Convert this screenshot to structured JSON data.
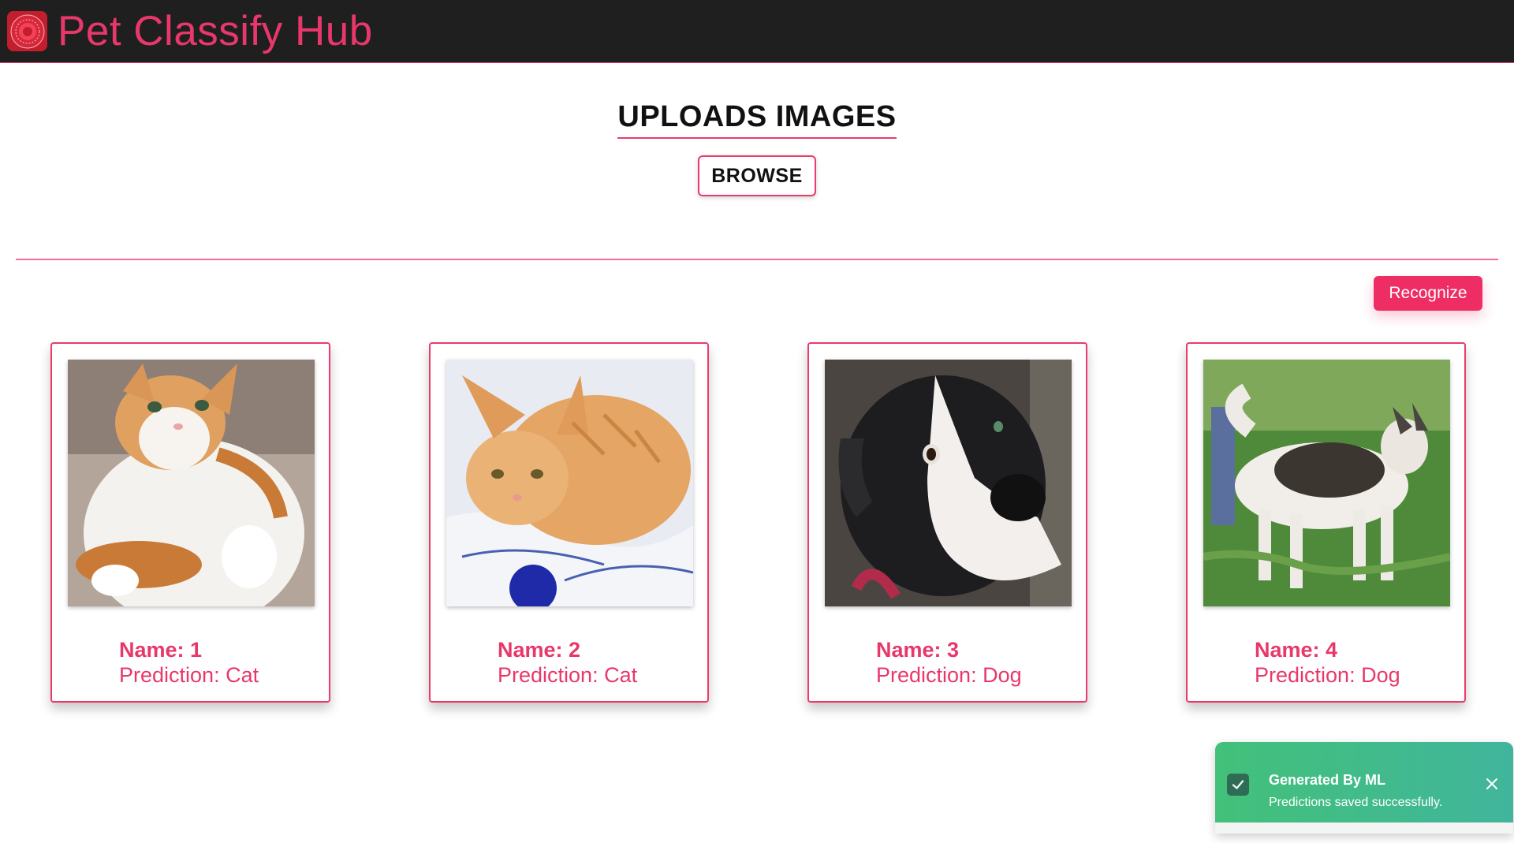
{
  "app": {
    "title": "Pet Classify Hub",
    "logo_icon": "paw-seal-icon",
    "accent_color": "#ea3b6c",
    "header_bg": "#201f1f"
  },
  "upload": {
    "heading": "UPLOADS IMAGES",
    "browse_label": "BROWSE"
  },
  "actions": {
    "recognize_label": "Recognize"
  },
  "results": [
    {
      "name_label": "Name: 1",
      "prediction_label": "Prediction: Cat",
      "image_subject": "orange-white-cat"
    },
    {
      "name_label": "Name: 2",
      "prediction_label": "Prediction: Cat",
      "image_subject": "orange-tabby-cat"
    },
    {
      "name_label": "Name: 3",
      "prediction_label": "Prediction: Dog",
      "image_subject": "black-white-dog"
    },
    {
      "name_label": "Name: 4",
      "prediction_label": "Prediction: Dog",
      "image_subject": "husky-on-grass"
    }
  ],
  "toast": {
    "title": "Generated By ML",
    "message": "Predictions saved successfully.",
    "icon": "check-icon",
    "close_icon": "close-icon",
    "color": "#42c179"
  }
}
